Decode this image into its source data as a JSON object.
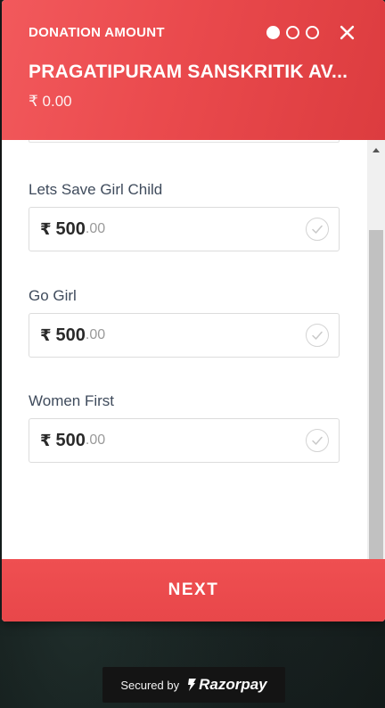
{
  "header": {
    "label": "DONATION AMOUNT",
    "merchant": "PRAGATIPURAM SANSKRITIK AV...",
    "amount": "₹ 0.00",
    "steps_total": 3,
    "active_step": 1,
    "bg_color": "#ea4a4d"
  },
  "fields": [
    {
      "label": "Lets Save Girl Child",
      "currency": "₹",
      "amount_int": "500",
      "amount_dec": ".00"
    },
    {
      "label": "Go Girl",
      "currency": "₹",
      "amount_int": "500",
      "amount_dec": ".00"
    },
    {
      "label": "Women First",
      "currency": "₹",
      "amount_int": "500",
      "amount_dec": ".00"
    }
  ],
  "actions": {
    "next_label": "NEXT"
  },
  "footer": {
    "secured_label": "Secured by",
    "brand": "Razorpay"
  },
  "icons": {
    "close": "close-icon",
    "check": "checkmark-icon",
    "brand": "razorpay-logo-icon",
    "scroll_up": "scroll-up-arrow-icon"
  },
  "colors": {
    "accent": "#ea4a4d",
    "text_label": "#3f4b5c"
  }
}
